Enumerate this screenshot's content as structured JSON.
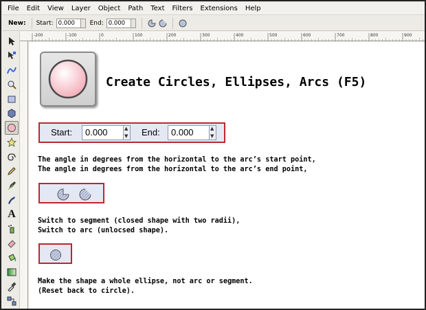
{
  "menubar": {
    "items": [
      "File",
      "Edit",
      "View",
      "Layer",
      "Object",
      "Path",
      "Text",
      "Filters",
      "Extensions",
      "Help"
    ]
  },
  "controls": {
    "new_label": "New:",
    "start_label": "Start:",
    "start_value": "0.000",
    "end_label": "End:",
    "end_value": "0.000"
  },
  "ruler": {
    "ticks": [
      "-200",
      "-100",
      "0",
      "100",
      "200",
      "300",
      "400",
      "500",
      "600",
      "700",
      "800",
      "900"
    ]
  },
  "toolbox": {
    "tools": [
      "selector-icon",
      "node-editor-icon",
      "tweak-icon",
      "zoom-icon",
      "rectangle-icon",
      "3d-box-icon",
      "ellipse-icon",
      "star-icon",
      "spiral-icon",
      "pencil-icon",
      "pen-icon",
      "calligraphy-icon",
      "text-icon",
      "spray-icon",
      "eraser-icon",
      "bucket-icon",
      "gradient-icon",
      "dropper-icon",
      "connector-icon"
    ]
  },
  "content": {
    "heading": "Create Circles, Ellipses, Arcs (F5)",
    "start_label": "Start:",
    "start_value": "0.000",
    "end_label": "End:",
    "end_value": "0.000",
    "desc1_line1": "The angle in degrees from the horizontal to the arc’s start point,",
    "desc1_line2": "The angle in degrees from the horizontal to the arc’s end point,",
    "desc2_line1": "Switch to segment (closed shape with two radii),",
    "desc2_line2": "Switch to arc (unlocsed shape).",
    "desc3_line1": "Make the shape a whole ellipse, not arc or segment.",
    "desc3_line2": "(Reset back to circle)."
  },
  "colors": {
    "highlight_border": "#c0242c",
    "control_panel": "#e4e8f4",
    "active_tool_fill": "#f4b8c0"
  }
}
